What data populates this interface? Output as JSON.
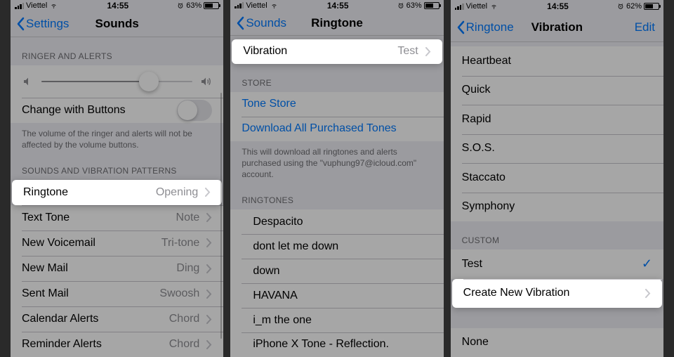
{
  "status": {
    "carrier": "Viettel",
    "time": "14:55",
    "battery_a": "63%",
    "battery_c": "62%"
  },
  "screen1": {
    "back": "Settings",
    "title": "Sounds",
    "sections": {
      "ringer_header": "RINGER AND ALERTS",
      "change_buttons": "Change with Buttons",
      "volume_note": "The volume of the ringer and alerts will not be affected by the volume buttons.",
      "patterns_header": "SOUNDS AND VIBRATION PATTERNS"
    },
    "rows": {
      "ringtone": {
        "label": "Ringtone",
        "value": "Opening"
      },
      "text_tone": {
        "label": "Text Tone",
        "value": "Note"
      },
      "voicemail": {
        "label": "New Voicemail",
        "value": "Tri-tone"
      },
      "new_mail": {
        "label": "New Mail",
        "value": "Ding"
      },
      "sent_mail": {
        "label": "Sent Mail",
        "value": "Swoosh"
      },
      "calendar": {
        "label": "Calendar Alerts",
        "value": "Chord"
      },
      "reminder": {
        "label": "Reminder Alerts",
        "value": "Chord"
      }
    }
  },
  "screen2": {
    "back": "Sounds",
    "title": "Ringtone",
    "vibration": {
      "label": "Vibration",
      "value": "Test"
    },
    "store_header": "STORE",
    "tone_store": "Tone Store",
    "download_all": "Download All Purchased Tones",
    "download_note": "This will download all ringtones and alerts purchased using the \"vuphung97@icloud.com\" account.",
    "ringtones_header": "RINGTONES",
    "ringtones": [
      "Despacito",
      "dont let me down",
      "down",
      "HAVANA",
      "i_m the one",
      "iPhone X Tone - Reflection."
    ]
  },
  "screen3": {
    "back": "Ringtone",
    "title": "Vibration",
    "edit": "Edit",
    "standard": [
      "Heartbeat",
      "Quick",
      "Rapid",
      "S.O.S.",
      "Staccato",
      "Symphony"
    ],
    "custom_header": "CUSTOM",
    "custom_item": "Test",
    "create_new": "Create New Vibration",
    "none": "None"
  }
}
